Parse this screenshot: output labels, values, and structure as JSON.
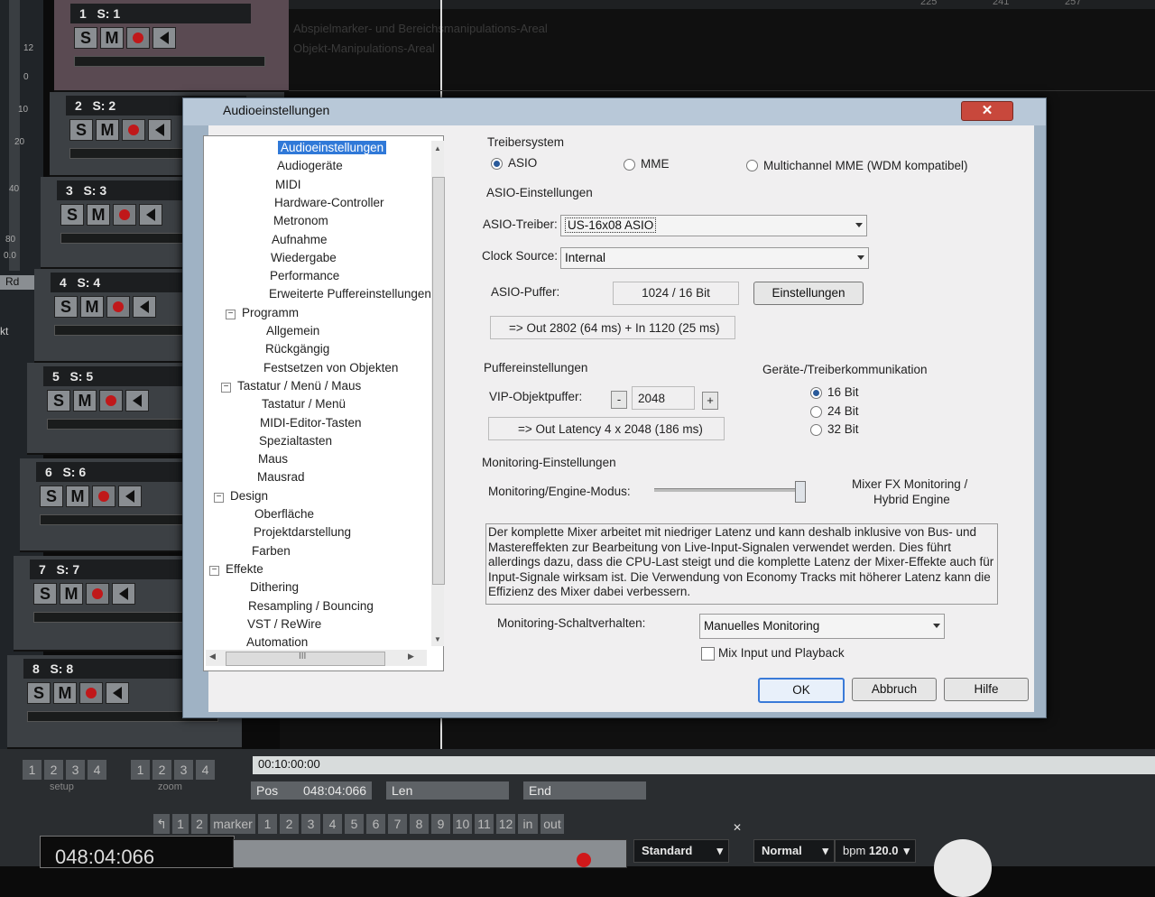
{
  "daw": {
    "top_ruler": [
      "225",
      "241",
      "257"
    ],
    "area_labels": [
      "Abspielmarker- und Bereichsmanipulations-Areal",
      "Objekt-Manipulations-Areal"
    ],
    "meter_scale": [
      "12",
      "0",
      "10",
      "20",
      "40",
      "80",
      "0.0"
    ],
    "side_labels": [
      "Rd",
      "kt"
    ],
    "tracks": [
      {
        "num": "1",
        "name": "S: 1"
      },
      {
        "num": "2",
        "name": "S: 2"
      },
      {
        "num": "3",
        "name": "S: 3"
      },
      {
        "num": "4",
        "name": "S: 4"
      },
      {
        "num": "5",
        "name": "S: 5"
      },
      {
        "num": "6",
        "name": "S: 6"
      },
      {
        "num": "7",
        "name": "S: 7"
      },
      {
        "num": "8",
        "name": "S: 8"
      }
    ],
    "solo_label": "S",
    "mute_label": "M",
    "setup_buttons": [
      "1",
      "2",
      "3",
      "4"
    ],
    "setup_label": "setup",
    "zoom_buttons": [
      "1",
      "2",
      "3",
      "4"
    ],
    "zoom_label": "zoom",
    "time_display": "00:10:00:00",
    "pos_label": "Pos",
    "pos_value": "048:04:066",
    "len_label": "Len",
    "end_label": "End",
    "marker_left": [
      "1",
      "2"
    ],
    "marker_label": "marker",
    "marker_numbers": [
      "1",
      "2",
      "3",
      "4",
      "5",
      "6",
      "7",
      "8",
      "9",
      "10",
      "11",
      "12"
    ],
    "in_label": "in",
    "out_label": "out",
    "big_time": "048:04:066",
    "standard_select": "Standard",
    "normal_select": "Normal",
    "bpm_label": "bpm",
    "bpm_value": "120.0"
  },
  "dialog": {
    "title": "Audioeinstellungen",
    "close_label": "✕",
    "tree": [
      {
        "label": "Audioeinstellungen",
        "level": 2,
        "selected": true
      },
      {
        "label": "Audiogeräte",
        "level": 2
      },
      {
        "label": "MIDI",
        "level": 2
      },
      {
        "label": "Hardware-Controller",
        "level": 2
      },
      {
        "label": "Metronom",
        "level": 2
      },
      {
        "label": "Aufnahme",
        "level": 2
      },
      {
        "label": "Wiedergabe",
        "level": 2
      },
      {
        "label": "Performance",
        "level": 2
      },
      {
        "label": "Erweiterte Puffereinstellungen",
        "level": 2
      },
      {
        "label": "Programm",
        "level": 1
      },
      {
        "label": "Allgemein",
        "level": 2
      },
      {
        "label": "Rückgängig",
        "level": 2
      },
      {
        "label": "Festsetzen von Objekten",
        "level": 2
      },
      {
        "label": "Tastatur / Menü / Maus",
        "level": 1
      },
      {
        "label": "Tastatur / Menü",
        "level": 2
      },
      {
        "label": "MIDI-Editor-Tasten",
        "level": 2
      },
      {
        "label": "Spezialtasten",
        "level": 2
      },
      {
        "label": "Maus",
        "level": 2
      },
      {
        "label": "Mausrad",
        "level": 2
      },
      {
        "label": "Design",
        "level": 1
      },
      {
        "label": "Oberfläche",
        "level": 2
      },
      {
        "label": "Projektdarstellung",
        "level": 2
      },
      {
        "label": "Farben",
        "level": 2
      },
      {
        "label": "Effekte",
        "level": 1
      },
      {
        "label": "Dithering",
        "level": 2
      },
      {
        "label": "Resampling / Bouncing",
        "level": 2
      },
      {
        "label": "VST / ReWire",
        "level": 2
      },
      {
        "label": "Automation",
        "level": 2
      }
    ],
    "driver_system_label": "Treibersystem",
    "driver_options": [
      "ASIO",
      "MME",
      "Multichannel MME (WDM kompatibel)"
    ],
    "driver_selected": "ASIO",
    "asio_section_label": "ASIO-Einstellungen",
    "asio_driver_label": "ASIO-Treiber:",
    "asio_driver_value": "US-16x08 ASIO",
    "clock_source_label": "Clock Source:",
    "clock_source_value": "Internal",
    "asio_buffer_label": "ASIO-Puffer:",
    "asio_buffer_value": "1024 / 16 Bit",
    "settings_button": "Einstellungen",
    "latency_info": "=> Out 2802 (64 ms) + In 1120 (25 ms)",
    "buffer_section_label": "Puffereinstellungen",
    "vip_buffer_label": "VIP-Objektpuffer:",
    "vip_buffer_value": "2048",
    "minus_label": "-",
    "plus_label": "+",
    "out_latency_info": "=> Out Latency 4 x 2048 (186 ms)",
    "device_comm_label": "Geräte-/Treiberkommunikation",
    "bit_options": [
      "16 Bit",
      "24 Bit",
      "32 Bit"
    ],
    "bit_selected": "16 Bit",
    "monitoring_section_label": "Monitoring-Einstellungen",
    "monitoring_mode_label": "Monitoring/Engine-Modus:",
    "monitoring_mode_value_line1": "Mixer FX Monitoring /",
    "monitoring_mode_value_line2": "Hybrid Engine",
    "monitoring_slider_position": 1.0,
    "monitoring_description": "Der komplette Mixer arbeitet mit niedriger Latenz und kann deshalb inklusive von Bus- und Mastereffekten zur Bearbeitung von Live-Input-Signalen verwendet werden. Dies führt allerdings dazu, dass die CPU-Last steigt und die komplette Latenz der Mixer-Effekte auch für Input-Signale wirksam ist. Die Verwendung von Economy Tracks mit höherer Latenz kann die Effizienz des Mixer dabei verbessern.",
    "switch_behavior_label": "Monitoring-Schaltverhalten:",
    "switch_behavior_value": "Manuelles Monitoring",
    "mix_checkbox_label": "Mix Input und Playback",
    "mix_checked": false,
    "ok_button": "OK",
    "cancel_button": "Abbruch",
    "help_button": "Hilfe",
    "hscroll_grip": "III"
  }
}
